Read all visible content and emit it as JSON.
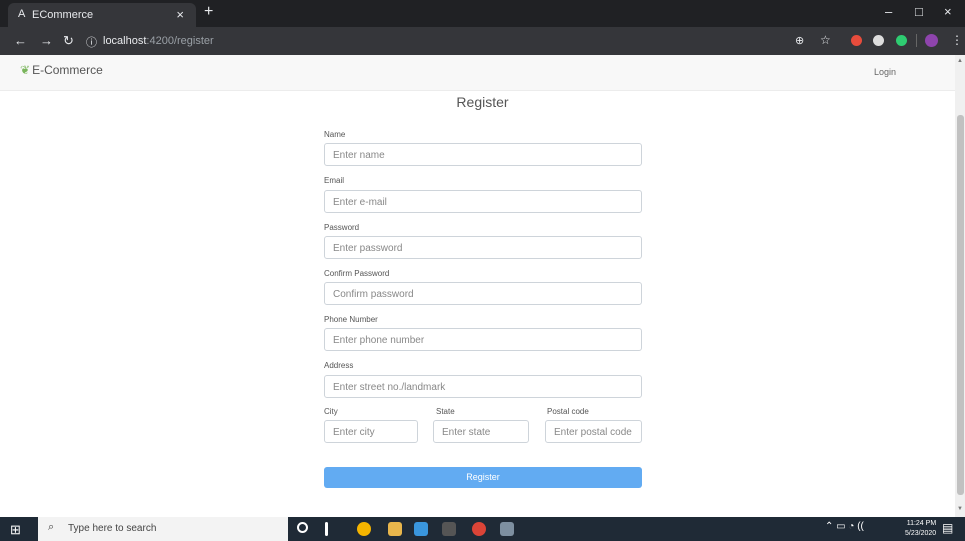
{
  "browser": {
    "tab_title": "ECommerce",
    "tab_close": "×",
    "new_tab": "+",
    "url_host": "localhost",
    "url_path": ":4200/register",
    "window_controls": [
      "–",
      "□",
      "×"
    ]
  },
  "app": {
    "brand": "E-Commerce",
    "login_link": "Login"
  },
  "form": {
    "title": "Register",
    "name_label": "Name",
    "name_placeholder": "Enter name",
    "email_label": "Email",
    "email_placeholder": "Enter e-mail",
    "password_label": "Password",
    "password_placeholder": "Enter password",
    "confirm_label": "Confirm Password",
    "confirm_placeholder": "Confirm password",
    "phone_label": "Phone Number",
    "phone_placeholder": "Enter phone number",
    "address_label": "Address",
    "address_placeholder": "Enter street no./landmark",
    "city_label": "City",
    "city_placeholder": "Enter city",
    "state_label": "State",
    "state_placeholder": "Enter state",
    "postal_label": "Postal code",
    "postal_placeholder": "Enter postal code",
    "submit_label": "Register"
  },
  "taskbar": {
    "search_placeholder": "Type here to search",
    "time": "11:24 PM",
    "date": "5/23/2020"
  },
  "colors": {
    "primary_button": "#62abf2",
    "browser_dark": "#202124",
    "taskbar": "#1f2a36"
  }
}
